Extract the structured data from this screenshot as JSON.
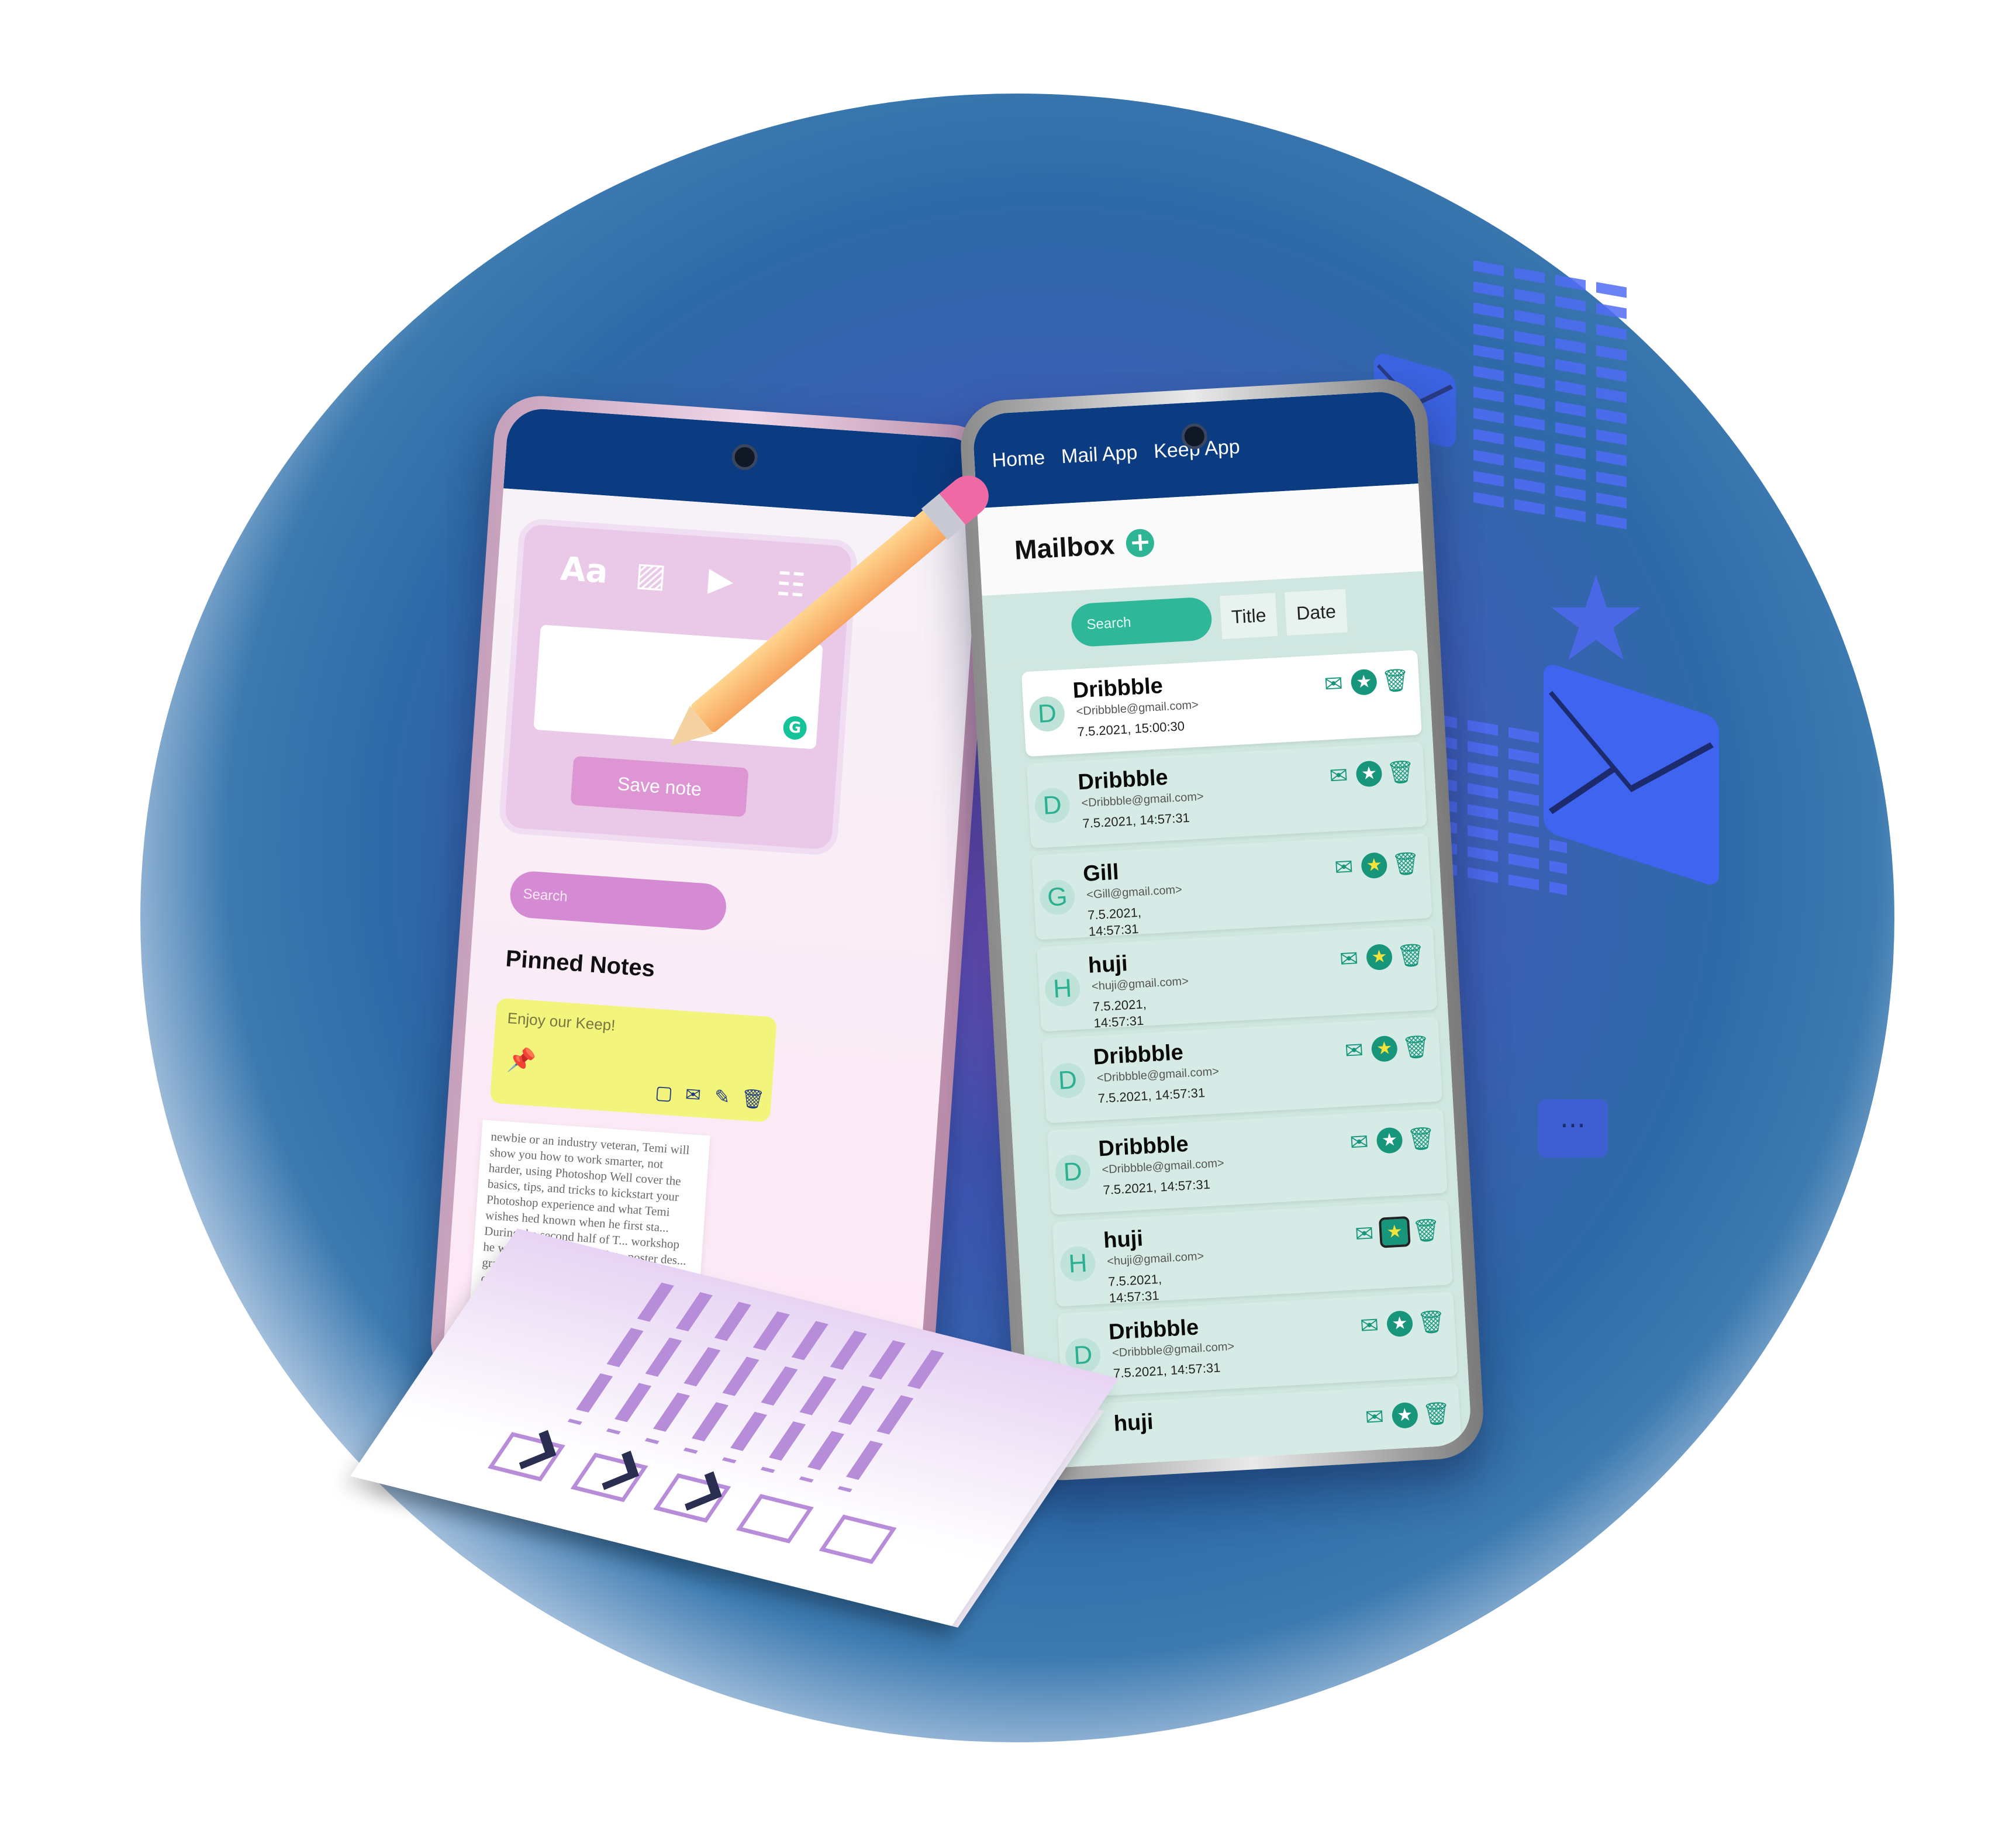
{
  "keep_app": {
    "tools": [
      "Aa",
      "image",
      "play",
      "clipboard"
    ],
    "save_button": "Save note",
    "search_placeholder": "Search",
    "pinned_title": "Pinned Notes",
    "pinned_note_text": "Enjoy our Keep!",
    "note_body": "newbie or an industry veteran, Temi will show you how to work smarter, not harder, using Photoshop Well cover the basics, tips, and tricks to kickstart your Photoshop experience and what Temi wishes hed known when he first sta... During the second half of T... workshop he will show u... approach to poster des... graphic design and m... Plus, youll get to c... LIVE alongside T... experience hi... receive an e... secret Ph... tips afte... the re..."
  },
  "mail_app": {
    "nav": [
      "Home",
      "Mail App",
      "Keep App"
    ],
    "title": "Mailbox",
    "search_placeholder": "Search",
    "filters": [
      "Title",
      "Date"
    ],
    "emails": [
      {
        "initial": "D",
        "sender": "Dribbble",
        "email": "<Dribbble@gmail.com>",
        "date": "7.5.2021, 15:00:30",
        "starred": false,
        "read": true
      },
      {
        "initial": "D",
        "sender": "Dribbble",
        "email": "<Dribbble@gmail.com>",
        "date": "7.5.2021, 14:57:31",
        "starred": false
      },
      {
        "initial": "G",
        "sender": "Gill",
        "email": "<Gill@gmail.com>",
        "date": "7.5.2021, 14:57:31",
        "starred": true
      },
      {
        "initial": "H",
        "sender": "huji",
        "email": "<huji@gmail.com>",
        "date": "7.5.2021, 14:57:31",
        "starred": true
      },
      {
        "initial": "D",
        "sender": "Dribbble",
        "email": "<Dribbble@gmail.com>",
        "date": "7.5.2021, 14:57:31",
        "starred": true
      },
      {
        "initial": "D",
        "sender": "Dribbble",
        "email": "<Dribbble@gmail.com>",
        "date": "7.5.2021, 14:57:31",
        "starred": false
      },
      {
        "initial": "H",
        "sender": "huji",
        "email": "<huji@gmail.com>",
        "date": "7.5.2021, 14:57:31",
        "starred": true,
        "selected": true
      },
      {
        "initial": "D",
        "sender": "Dribbble",
        "email": "<Dribbble@gmail.com>",
        "date": "7.5.2021, 14:57:31",
        "starred": false
      },
      {
        "initial": "",
        "sender": "huji",
        "email": "",
        "date": "",
        "starred": false
      }
    ]
  },
  "colors": {
    "nav_bg": "#0b3c82",
    "accent_teal": "#2fb79a",
    "keep_pink": "#de95d4",
    "note_yellow": "#f3f47c"
  }
}
